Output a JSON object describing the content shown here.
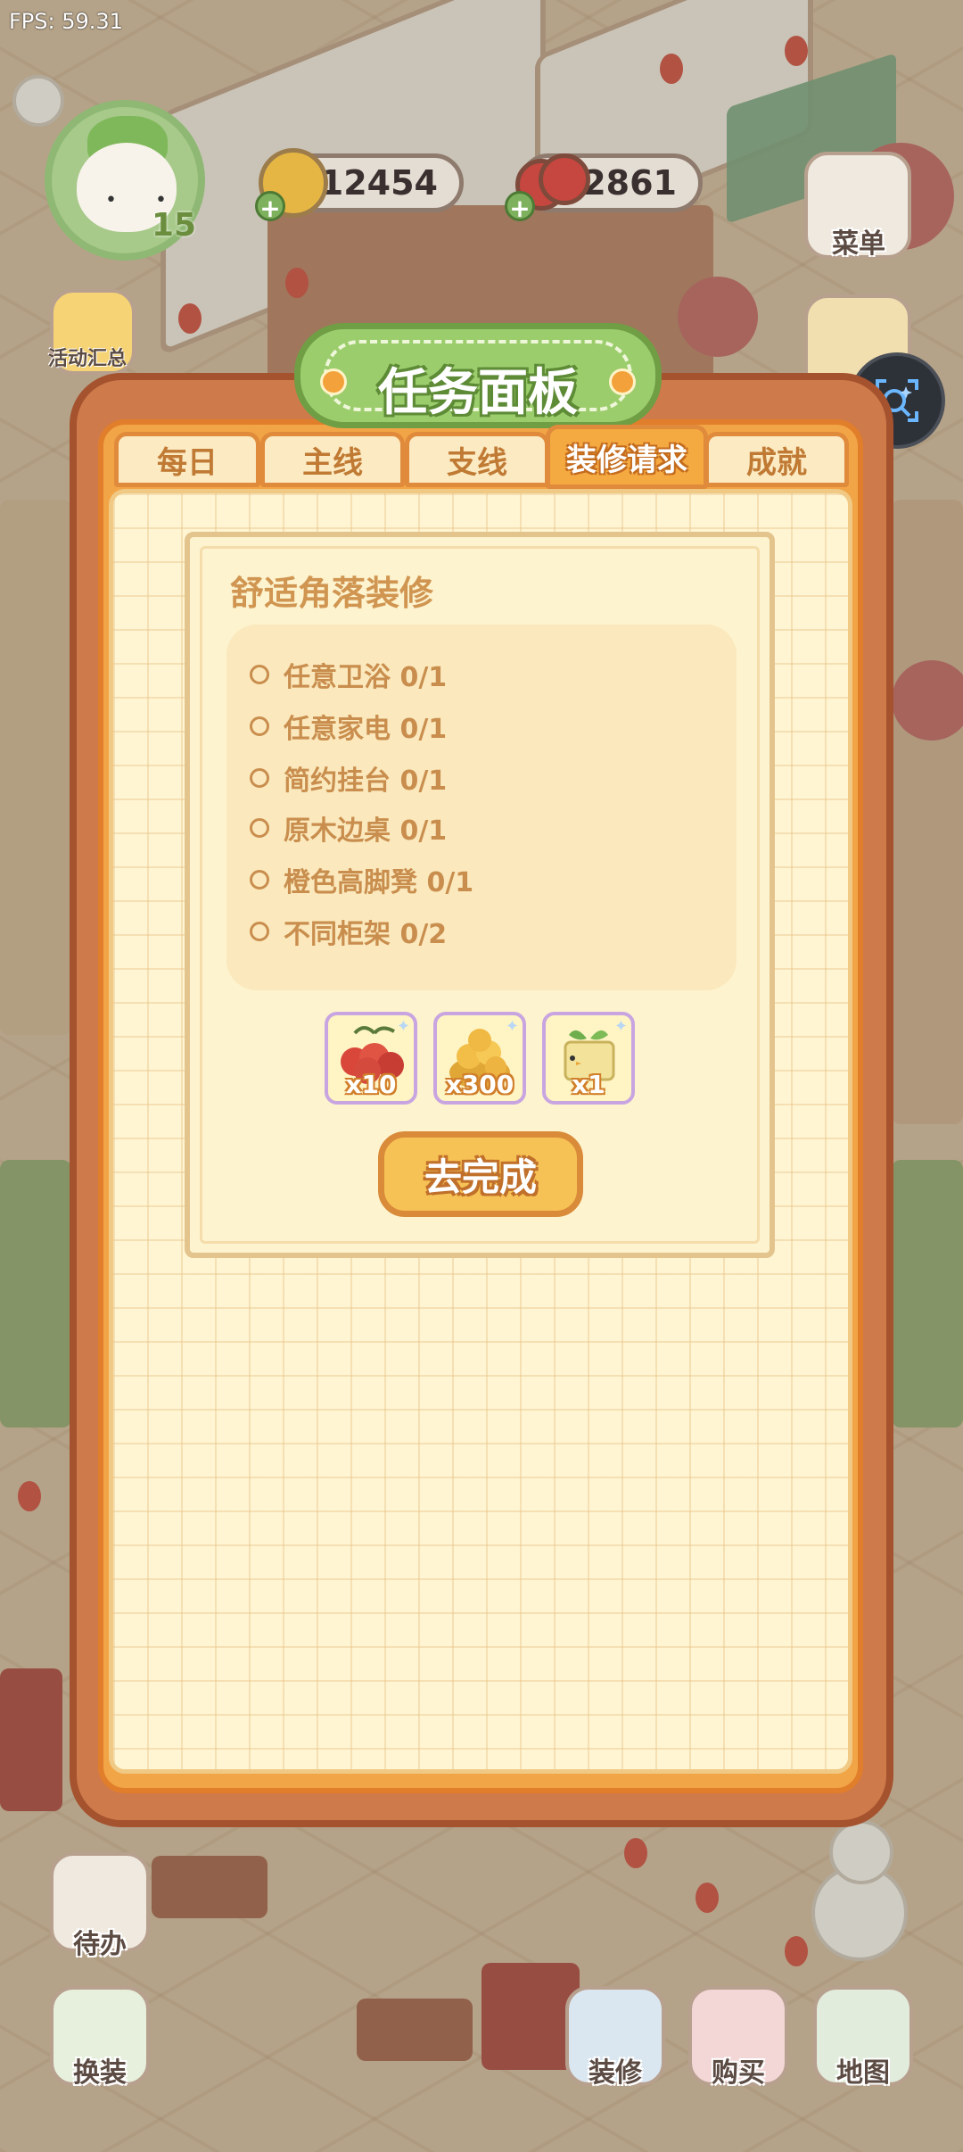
{
  "hud": {
    "fps": "FPS: 59.31",
    "level": "15",
    "coins": "12454",
    "cherries": "2861"
  },
  "side_buttons": {
    "menu": "菜单",
    "events": "活动汇总",
    "todo": "待办",
    "outfit": "换装",
    "decorate": "装修",
    "buy": "购买",
    "map": "地图"
  },
  "panel": {
    "title": "任务面板",
    "tabs": [
      {
        "label": "每日",
        "active": false
      },
      {
        "label": "主线",
        "active": false
      },
      {
        "label": "支线",
        "active": false
      },
      {
        "label": "装修请求",
        "active": true
      },
      {
        "label": "成就",
        "active": false
      }
    ],
    "task": {
      "title": "舒适角落装修",
      "requirements": [
        "任意卫浴 0/1",
        "任意家电 0/1",
        "简约挂台 0/1",
        "原木边桌 0/1",
        "橙色高脚凳 0/1",
        "不同柜架 0/2"
      ],
      "rewards": [
        {
          "icon": "cherry-icon",
          "count": "x10"
        },
        {
          "icon": "gold-coins-icon",
          "count": "x300"
        },
        {
          "icon": "sprout-box-icon",
          "count": "x1"
        }
      ],
      "go_button": "去完成"
    }
  },
  "colors": {
    "panel_frame": "#cf7a4b",
    "panel_orange": "#f2a546",
    "paper": "#fff5d3",
    "banner_green": "#9ccd6d",
    "button_yellow": "#f7c255"
  }
}
